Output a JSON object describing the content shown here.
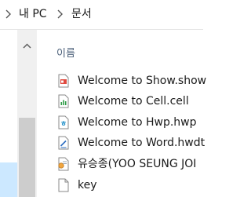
{
  "breadcrumb": {
    "item1": "내 PC",
    "item2": "문서"
  },
  "list": {
    "column_name": "이름",
    "files": [
      {
        "name": "Welcome to Show.show",
        "icon": "show-file-icon"
      },
      {
        "name": "Welcome to Cell.cell",
        "icon": "cell-file-icon"
      },
      {
        "name": "Welcome to Hwp.hwp",
        "icon": "hwp-file-icon"
      },
      {
        "name": "Welcome to Word.hwdt",
        "icon": "word-file-icon"
      },
      {
        "name": "유승종(YOO SEUNG JOI",
        "icon": "certificate-file-icon"
      },
      {
        "name": "key",
        "icon": "blank-file-icon"
      }
    ]
  },
  "colors": {
    "nav_selected": "#cce8ff",
    "show": "#e04a3f",
    "cell": "#2e9b46",
    "hwp": "#1f8fc9",
    "word": "#2b6cc0"
  }
}
